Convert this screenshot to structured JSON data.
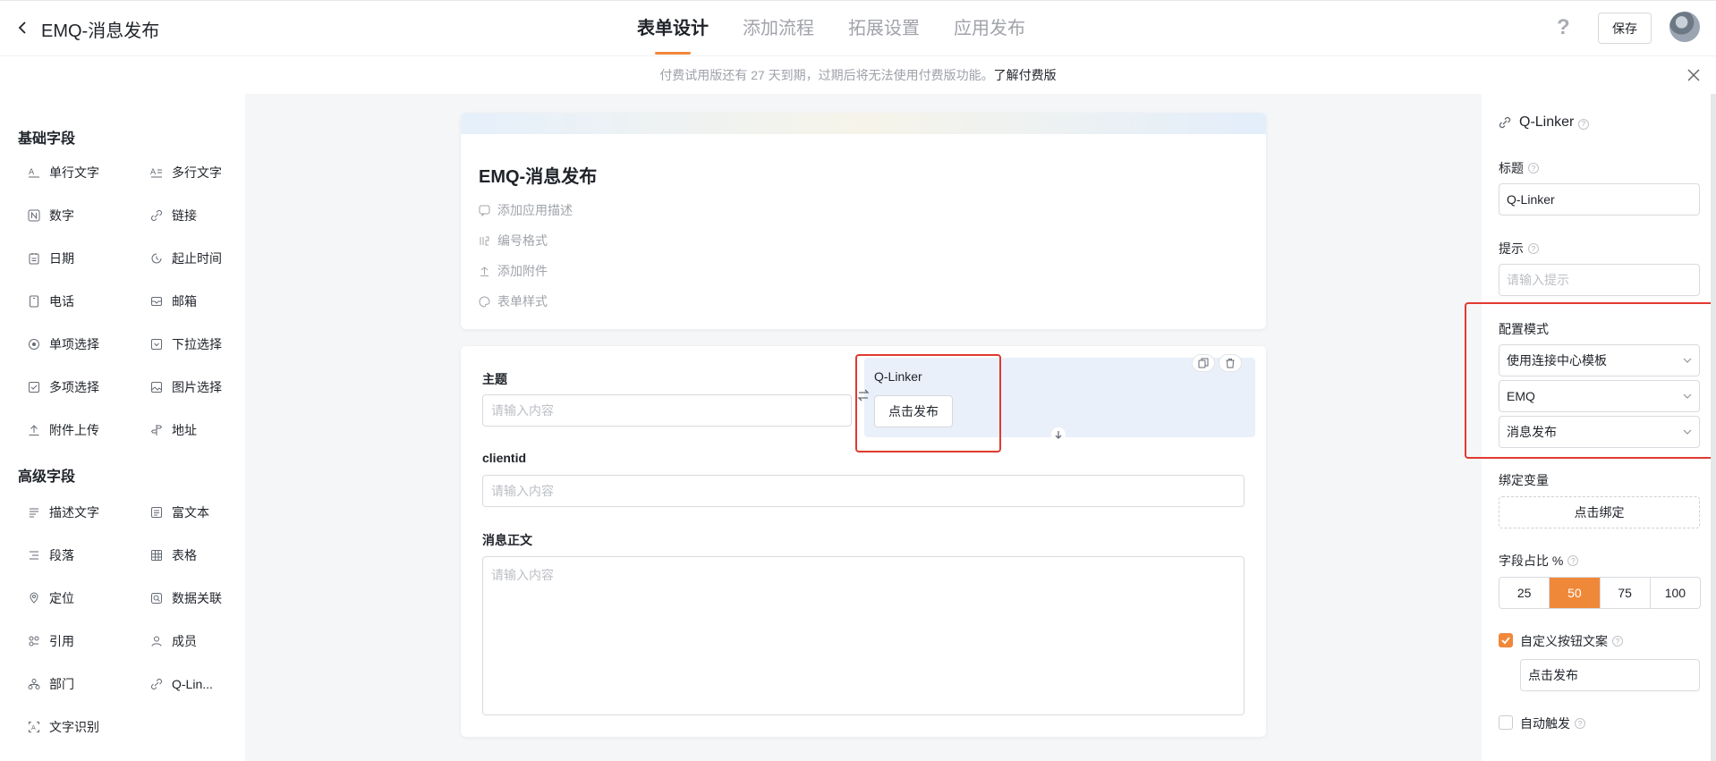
{
  "header": {
    "title": "EMQ-消息发布",
    "tabs": [
      "表单设计",
      "添加流程",
      "拓展设置",
      "应用发布"
    ],
    "help": "?",
    "save_label": "保存"
  },
  "banner": {
    "text": "付费试用版还有 27 天到期，过期后将无法使用付费版功能。",
    "link": "了解付费版"
  },
  "left_panel": {
    "basic_title": "基础字段",
    "basic_fields": [
      {
        "label": "单行文字",
        "icon": "single-line-text-icon"
      },
      {
        "label": "多行文字",
        "icon": "multi-line-text-icon"
      },
      {
        "label": "数字",
        "icon": "number-icon"
      },
      {
        "label": "链接",
        "icon": "link-icon"
      },
      {
        "label": "日期",
        "icon": "date-icon"
      },
      {
        "label": "起止时间",
        "icon": "time-range-icon"
      },
      {
        "label": "电话",
        "icon": "phone-icon"
      },
      {
        "label": "邮箱",
        "icon": "mail-icon"
      },
      {
        "label": "单项选择",
        "icon": "radio-icon"
      },
      {
        "label": "下拉选择",
        "icon": "dropdown-icon"
      },
      {
        "label": "多项选择",
        "icon": "checkbox-icon"
      },
      {
        "label": "图片选择",
        "icon": "image-select-icon"
      },
      {
        "label": "附件上传",
        "icon": "upload-icon"
      },
      {
        "label": "地址",
        "icon": "address-icon"
      }
    ],
    "advanced_title": "高级字段",
    "advanced_fields": [
      {
        "label": "描述文字",
        "icon": "description-icon"
      },
      {
        "label": "富文本",
        "icon": "rich-text-icon"
      },
      {
        "label": "段落",
        "icon": "paragraph-icon"
      },
      {
        "label": "表格",
        "icon": "table-icon"
      },
      {
        "label": "定位",
        "icon": "location-icon"
      },
      {
        "label": "数据关联",
        "icon": "data-link-icon"
      },
      {
        "label": "引用",
        "icon": "reference-icon"
      },
      {
        "label": "成员",
        "icon": "member-icon"
      },
      {
        "label": "部门",
        "icon": "department-icon"
      },
      {
        "label": "Q-Lin...",
        "icon": "q-linker-icon"
      },
      {
        "label": "文字识别",
        "icon": "ocr-icon"
      }
    ]
  },
  "form_info": {
    "title": "EMQ-消息发布",
    "add_description": "添加应用描述",
    "number_format": "编号格式",
    "add_attachment": "添加附件",
    "form_style": "表单样式"
  },
  "form": {
    "subject_label": "主题",
    "subject_placeholder": "请输入内容",
    "qlinker_label": "Q-Linker",
    "qlinker_button": "点击发布",
    "clientid_label": "clientid",
    "clientid_placeholder": "请输入内容",
    "body_label": "消息正文",
    "body_placeholder": "请输入内容"
  },
  "right_panel": {
    "component_name": "Q-Linker",
    "title_label": "标题",
    "title_value": "Q-Linker",
    "hint_label": "提示",
    "hint_placeholder": "请输入提示",
    "config_mode_label": "配置模式",
    "config_mode_value": "使用连接中心模板",
    "connector_value": "EMQ",
    "action_value": "消息发布",
    "bind_var_label": "绑定变量",
    "bind_button": "点击绑定",
    "width_label": "字段占比 %",
    "width_options": [
      "25",
      "50",
      "75",
      "100"
    ],
    "width_selected": "50",
    "custom_btn_label": "自定义按钮文案",
    "custom_btn_checked": true,
    "custom_btn_value": "点击发布",
    "auto_trigger_label": "自动触发",
    "auto_trigger_checked": false
  },
  "colors": {
    "accent": "#f0883a",
    "highlight": "#e03a2f"
  }
}
